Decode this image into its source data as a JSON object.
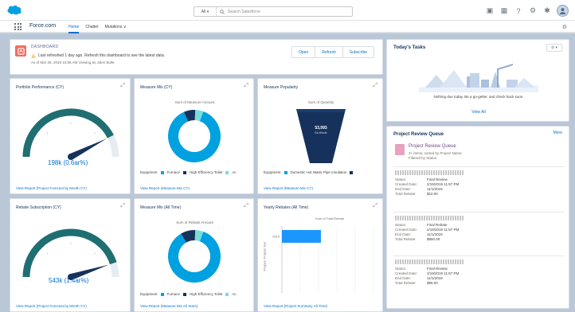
{
  "header": {
    "search_scope": "All ▾",
    "search_placeholder": "Search Salesforce"
  },
  "nav": {
    "app_name": "Force.com",
    "tabs": [
      "Home",
      "Chatter",
      "Mutations ∨"
    ]
  },
  "dashboard": {
    "subtitle": "DASHBOARD",
    "warning": "Last refreshed 1 day ago. Refresh this dashboard to see the latest data.",
    "meta": "As of Mar 26, 2019 10:55 AM Viewing as Jolen Bolle",
    "buttons": [
      "Open",
      "Refresh",
      "Subscribe"
    ]
  },
  "widgets": {
    "w1": {
      "title": "Portfolio Performance (CY)",
      "value": "198k (0.6ar%)",
      "footer": "View Report (Project Forecast by Month CY)"
    },
    "w2": {
      "title": "Measure Mix (CY)",
      "chart_title": "Sum of Measure Amount",
      "legend_label": "Equipment",
      "legend_items": [
        "Furnace",
        "High Efficiency Toilet",
        "Ac"
      ],
      "footer": "View Report (Measure Mix CY)"
    },
    "w3": {
      "title": "Measure Popularity",
      "chart_title": "Sum of Quantity",
      "funnel_value": "53,993",
      "funnel_sub": "Ba Whole",
      "legend_label": "Equipment",
      "legend_items": [
        "Domestic Hot Water Pipe Insulation"
      ],
      "footer": "View Report (Measure Mix CY)"
    },
    "w4": {
      "title": "Rebate Subscription (CY)",
      "value": "543k (1.4ar%)",
      "footer": "View Report (Project Forecast by Month CY)"
    },
    "w5": {
      "title": "Measure Mix (All Time)",
      "chart_title": "Sum of Rebate Amount",
      "legend_label": "Equipment",
      "legend_items": [
        "Furnace",
        "High Efficiency Toilet",
        "Ac"
      ],
      "footer": "View Report (Measure Mix All Stars)"
    },
    "w6": {
      "title": "Yearly Rebates (All Time)",
      "chart_title": "Sum of Total Rebate",
      "ylabel": "Program: Program Year",
      "footer": "View Report (Project Summary All Time)"
    }
  },
  "tasks": {
    "title": "Today's Tasks",
    "filter": "⊘ ▾",
    "message": "Nothing due today. Be a go-getter, and check back soon.",
    "link": "View All"
  },
  "queue": {
    "title": "Project Review Queue",
    "more": "More",
    "name": "Project Review Queue",
    "sub1": "3+ items, sorted by Project Name",
    "sub2": "Filtered by Status",
    "items": [
      {
        "rows": [
          [
            "Status:",
            "Final Review"
          ],
          [
            "Created Date:",
            "2/19/2019 11:57 PM"
          ],
          [
            "End Date:",
            "11/1/2019"
          ],
          [
            "Total Rebate:",
            "$10.00"
          ]
        ]
      },
      {
        "rows": [
          [
            "Status:",
            "Final Rebate"
          ],
          [
            "Created Date:",
            "2/19/2019 11:57 PM"
          ],
          [
            "End Date:",
            "11/1/2019"
          ],
          [
            "Total Rebate:",
            "$850.00"
          ]
        ]
      },
      {
        "rows": [
          [
            "Status:",
            "Final Review"
          ],
          [
            "Created Date:",
            "2/19/2019 11:57 PM"
          ],
          [
            "End Date:",
            "11/1/2019"
          ],
          [
            "Total Rebate:",
            "$95.00"
          ]
        ]
      }
    ]
  },
  "colors": {
    "brand": "#00a1e0",
    "link": "#0070d2",
    "gauge": "#1f6e72",
    "dark": "#16325c"
  },
  "chart_data": [
    {
      "type": "gauge",
      "title": "Portfolio Performance (CY)",
      "value_text": "198k (0.6ar%)",
      "fill_fraction": 0.85
    },
    {
      "type": "donut",
      "title": "Measure Mix (CY)",
      "categories": [
        "Furnace",
        "High Efficiency Toilet",
        "Ac"
      ],
      "values": [
        88,
        7,
        5
      ]
    },
    {
      "type": "funnel",
      "title": "Measure Popularity",
      "categories": [
        "Domestic Hot Water Pipe Insulation"
      ],
      "values": [
        53993
      ]
    },
    {
      "type": "gauge",
      "title": "Rebate Subscription (CY)",
      "value_text": "543k (1.4ar%)",
      "fill_fraction": 0.9
    },
    {
      "type": "donut",
      "title": "Measure Mix (All Time)",
      "categories": [
        "Furnace",
        "High Efficiency Toilet",
        "Ac"
      ],
      "values": [
        86,
        9,
        5
      ]
    },
    {
      "type": "bar",
      "title": "Yearly Rebates (All Time)",
      "categories": [
        "2019"
      ],
      "values": [
        2.3
      ],
      "xlim": [
        0,
        10
      ]
    }
  ]
}
